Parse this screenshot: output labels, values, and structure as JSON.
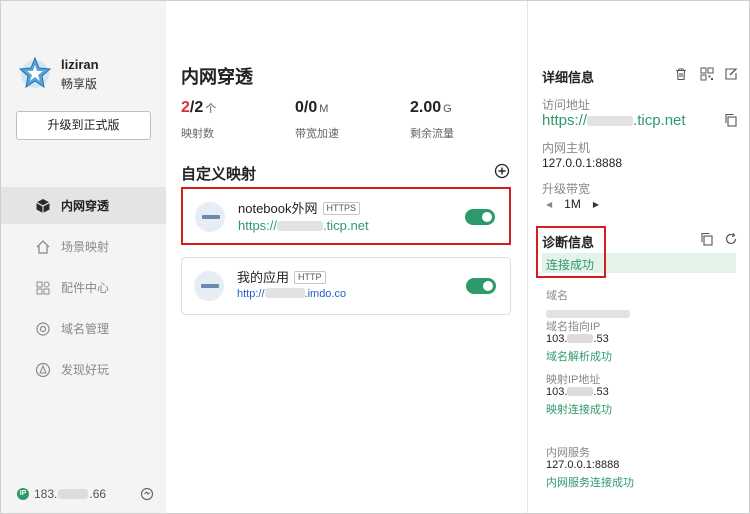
{
  "titlebar": {
    "qr_icon": "qrcode-icon",
    "menu_icon": "menu-icon",
    "minimize_icon": "minimize-icon",
    "close_icon": "close-icon"
  },
  "sidebar": {
    "user": {
      "name": "liziran",
      "plan": "畅享版"
    },
    "upgrade_label": "升级到正式版",
    "items": [
      {
        "label": "内网穿透",
        "icon": "cube-icon",
        "active": true
      },
      {
        "label": "场景映射",
        "icon": "home-icon",
        "active": false
      },
      {
        "label": "配件中心",
        "icon": "grid-icon",
        "active": false
      },
      {
        "label": "域名管理",
        "icon": "globe-icon",
        "active": false
      },
      {
        "label": "发现好玩",
        "icon": "compass-icon",
        "active": false
      }
    ],
    "ip": {
      "badge": "IP",
      "prefix": "183.",
      "suffix": ".66"
    }
  },
  "main": {
    "title": "内网穿透",
    "stats": [
      {
        "current": "2",
        "total": "/2",
        "unit": "个",
        "label": "映射数"
      },
      {
        "current": "0",
        "total": "/0",
        "unit": "M",
        "label": "带宽加速"
      },
      {
        "current": "2.00",
        "total": "",
        "unit": "G",
        "label": "剩余流量"
      }
    ],
    "section_title": "自定义映射",
    "mappings": [
      {
        "name": "notebook外网",
        "protocol": "HTTPS",
        "url_prefix": "https://",
        "url_suffix": ".ticp.net",
        "enabled": true
      },
      {
        "name": "我的应用",
        "protocol": "HTTP",
        "url_prefix": "http://",
        "url_suffix": ".imdo.co",
        "enabled": true
      }
    ]
  },
  "detail": {
    "title": "详细信息",
    "access_label": "访问地址",
    "access_prefix": "https://",
    "access_suffix": ".ticp.net",
    "host_label": "内网主机",
    "host_value": "127.0.0.1:8888",
    "bandwidth_label": "升级带宽",
    "bandwidth_value": "1M",
    "diag_title": "诊断信息",
    "diag_status": "连接成功",
    "domain_label": "域名",
    "domain_ip_label": "域名指向IP",
    "domain_ip_prefix": "103.",
    "domain_ip_suffix": ".53",
    "domain_ok": "域名解析成功",
    "map_ip_label": "映射IP地址",
    "map_ip_prefix": "103.",
    "map_ip_suffix": ".53",
    "map_ok": "映射连接成功",
    "service_label": "内网服务",
    "service_value": "127.0.0.1:8888",
    "service_ok": "内网服务连接成功"
  },
  "colors": {
    "accent_green": "#2e9a6b",
    "highlight_red": "#d41f1f",
    "link_blue": "#2361c4"
  }
}
